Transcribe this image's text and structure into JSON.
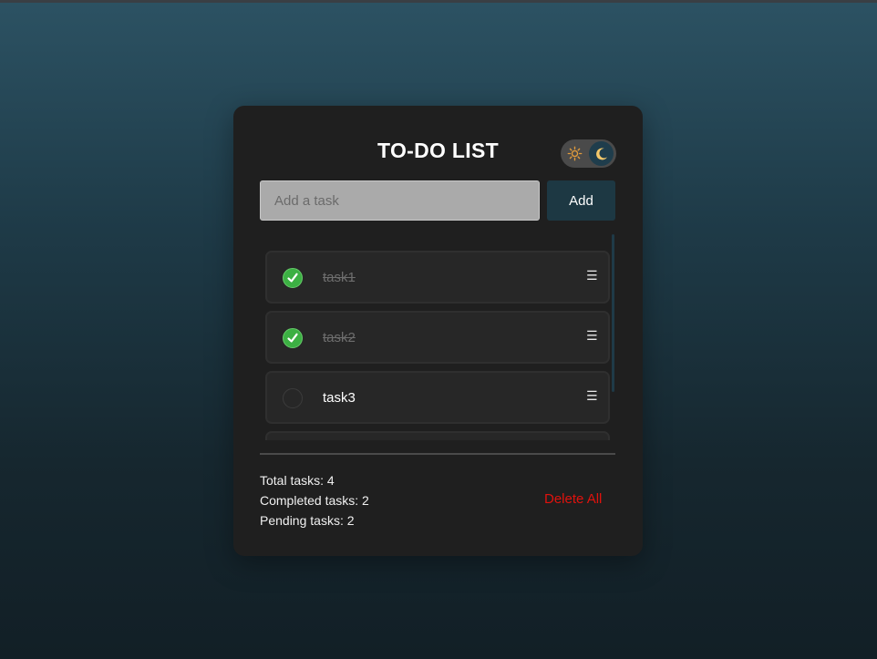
{
  "app": {
    "title": "TO-DO LIST",
    "theme": "dark",
    "accent_color": "#1d3843",
    "theme_toggle": {
      "sun_icon": "sun-icon",
      "moon_icon": "moon-icon",
      "mode": "dark"
    }
  },
  "input": {
    "placeholder": "Add a task",
    "value": ""
  },
  "add_button": {
    "label": "Add"
  },
  "tasks": [
    {
      "label": "task1",
      "completed": true,
      "handle": "☰"
    },
    {
      "label": "task2",
      "completed": true,
      "handle": "☰"
    },
    {
      "label": "task3",
      "completed": false,
      "handle": "☰"
    }
  ],
  "stats": {
    "total": "Total tasks: 4",
    "completed": "Completed tasks: 2",
    "pending": "Pending tasks: 2"
  },
  "delete_all": {
    "label": "Delete All",
    "color": "#e0120d"
  }
}
